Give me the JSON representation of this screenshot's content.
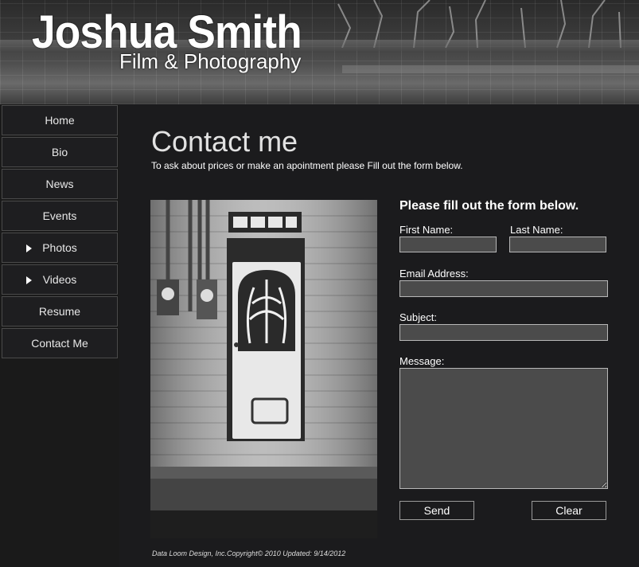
{
  "header": {
    "name": "Joshua Smith",
    "tagline": "Film & Photography"
  },
  "nav": [
    {
      "label": "Home",
      "has_submenu": false
    },
    {
      "label": "Bio",
      "has_submenu": false
    },
    {
      "label": "News",
      "has_submenu": false
    },
    {
      "label": "Events",
      "has_submenu": false
    },
    {
      "label": "Photos",
      "has_submenu": true
    },
    {
      "label": "Videos",
      "has_submenu": true
    },
    {
      "label": "Resume",
      "has_submenu": false
    },
    {
      "label": "Contact Me",
      "has_submenu": false
    }
  ],
  "page": {
    "title": "Contact me",
    "subtitle": "To ask about prices or make an apointment please Fill out the form below.",
    "footer": "Data Loom Design, Inc.Copyright© 2010 Updated: 9/14/2012"
  },
  "form": {
    "title": "Please fill out the form below.",
    "first_name_label": "First Name:",
    "last_name_label": "Last Name:",
    "email_label": "Email Address:",
    "subject_label": "Subject:",
    "message_label": "Message:",
    "first_name_value": "",
    "last_name_value": "",
    "email_value": "",
    "subject_value": "",
    "message_value": "",
    "send_label": "Send",
    "clear_label": "Clear"
  },
  "colors": {
    "background": "#1b1b1d",
    "input_fill": "#4b4b4b",
    "nav_border": "#4a4a4a"
  }
}
